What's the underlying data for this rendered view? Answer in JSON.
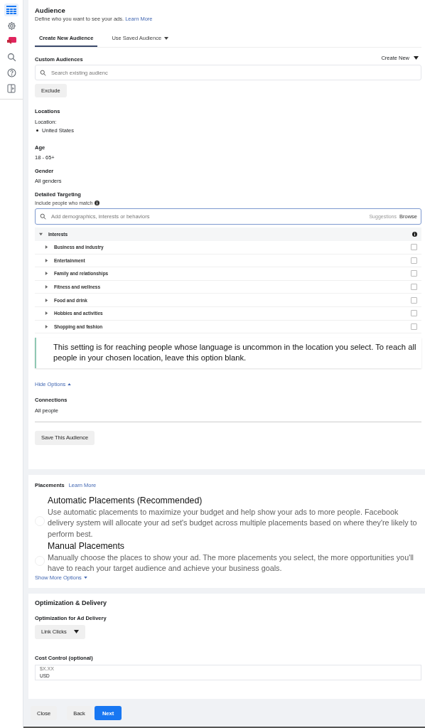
{
  "sidebar": {
    "items": [
      {
        "selected": true
      },
      {
        "selected": false
      },
      {
        "selected": false
      },
      {
        "selected": false
      },
      {
        "selected": false
      },
      {
        "selected": false
      }
    ]
  },
  "audience": {
    "title": "Audience",
    "subtitle": "Define who you want to see your ads.",
    "learn_more": "Learn More",
    "tabs": [
      {
        "label": "Create New Audience",
        "selected": true,
        "dropdown": false
      },
      {
        "label": "Use Saved Audience",
        "selected": false,
        "dropdown": true
      }
    ],
    "custom_audiences": {
      "label": "Custom Audiences",
      "create_new": "Create New",
      "search": {
        "placeholder": "Search existing audienc"
      },
      "exclude": "Exclude"
    },
    "locations": {
      "label": "Locations",
      "sublabel": "Location:",
      "items": [
        "United States"
      ]
    },
    "age": {
      "label": "Age",
      "value": "18 - 65+"
    },
    "gender": {
      "label": "Gender",
      "value": "All genders"
    },
    "detailed_targeting": {
      "label": "Detailed Targeting",
      "hint": "Include people who match",
      "search": {
        "placeholder": "Add demographics, interests or behaviors"
      },
      "suggestions": "Suggestions",
      "browse": "Browse",
      "tree": [
        {
          "label": "Interests",
          "expanded": true,
          "children": [
            {
              "label": "Business and industry",
              "expanded": false,
              "checked": false
            },
            {
              "label": "Entertainment",
              "expanded": false,
              "checked": false
            },
            {
              "label": "Family and relationships",
              "expanded": false,
              "checked": false
            },
            {
              "label": "Fitness and wellness",
              "expanded": false,
              "checked": false
            },
            {
              "label": "Food and drink",
              "expanded": false,
              "checked": false
            },
            {
              "label": "Hobbies and activities",
              "expanded": false,
              "checked": false
            },
            {
              "label": "Shopping and fashion",
              "expanded": false,
              "checked": false
            }
          ]
        }
      ]
    },
    "notice": "This setting is for reaching people whose language is uncommon in the location you select. To reach all people in your chosen location, leave this option blank.",
    "hide_options": "Hide Options",
    "connections": {
      "label": "Connections",
      "value": "All people"
    },
    "save_button": "Save This Audience"
  },
  "placements": {
    "title": "Placements",
    "learn_more": "Learn More",
    "options": [
      {
        "title": "Automatic Placements (Recommended)",
        "description": "Use automatic placements to maximize your budget and help show your ads to more people. Facebook delivery system will allocate your ad set's budget across multiple placements based on where they're likely to perform best.",
        "selected": false
      },
      {
        "title": "Manual Placements",
        "description": "Manually choose the places to show your ad. The more placements you select, the more opportunities you'll have to reach your target audience and achieve your business goals.",
        "selected": false
      }
    ],
    "show_more": "Show More Options"
  },
  "optimization": {
    "title": "Optimization & Delivery",
    "delivery_label": "Optimization for Ad Delivery",
    "delivery_value": "Link Clicks",
    "cost_label": "Cost Control (optional)",
    "cost_field": {
      "placeholder": "$X.XX",
      "currency": "USD"
    }
  },
  "footer": [
    {
      "label": "Close",
      "kind": "secondary"
    },
    {
      "label": "Back",
      "kind": "secondary"
    },
    {
      "label": "Next",
      "kind": "primary"
    }
  ]
}
